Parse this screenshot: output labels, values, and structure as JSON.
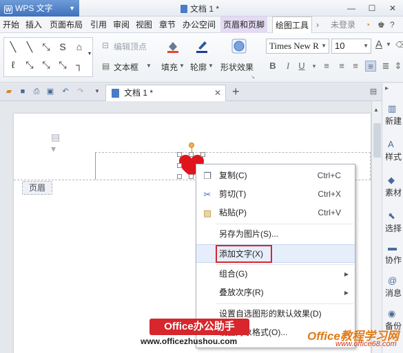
{
  "titlebar": {
    "app_name": "WPS 文字",
    "doc_title": "文档 1 *"
  },
  "menu": {
    "items": [
      "开始",
      "插入",
      "页面布局",
      "引用",
      "审阅",
      "视图",
      "章节",
      "办公空间",
      "页眉和页脚",
      "绘图工具"
    ],
    "login": "未登录"
  },
  "ribbon": {
    "edit_points": "编辑顶点",
    "textbox": "文本框",
    "fill": "填充",
    "outline": "轮廓",
    "shape_effects": "形状效果",
    "font_name": "Times New R",
    "font_size": "10"
  },
  "tab": {
    "label": "文档 1 *"
  },
  "document": {
    "header_tag": "页眉"
  },
  "sidebar": {
    "items": [
      "新建",
      "样式",
      "素材",
      "选择",
      "协作",
      "消息",
      "备份"
    ]
  },
  "context_menu": {
    "items": [
      {
        "label": "复制(C)",
        "shortcut": "Ctrl+C"
      },
      {
        "label": "剪切(T)",
        "shortcut": "Ctrl+X"
      },
      {
        "label": "粘贴(P)",
        "shortcut": "Ctrl+V"
      },
      {
        "label": "另存为图片(S)..."
      },
      {
        "label": "添加文字(X)"
      },
      {
        "label": "组合(G)"
      },
      {
        "label": "叠放次序(R)"
      },
      {
        "label": "设置自选图形的默认效果(D)"
      },
      {
        "label": "设置对象格式(O)..."
      }
    ]
  },
  "watermark": {
    "badge": "Office办公助手",
    "url": "www.officezhushou.com",
    "right": "Office教程学习网",
    "right_url": "www.office68.com"
  },
  "colors": {
    "accent": "#3f72bd",
    "highlight_box": "#d6262f",
    "heart": "#e0141c"
  }
}
